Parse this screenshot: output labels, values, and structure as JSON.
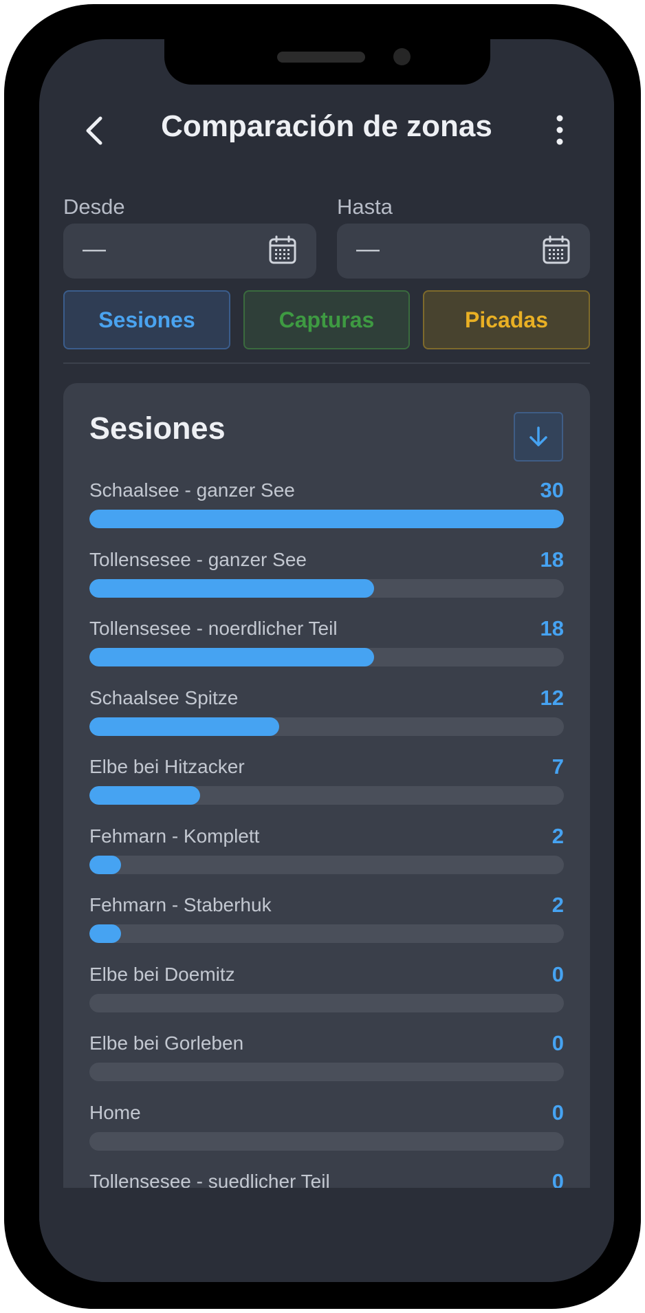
{
  "header": {
    "title": "Comparación de zonas"
  },
  "filters": {
    "from_label": "Desde",
    "from_value": "—",
    "to_label": "Hasta",
    "to_value": "—"
  },
  "metric_buttons": {
    "sesiones": "Sesiones",
    "capturas": "Capturas",
    "picadas": "Picadas"
  },
  "card": {
    "title": "Sesiones",
    "max_value": 30,
    "rows": [
      {
        "label": "Schaalsee - ganzer See",
        "value": 30
      },
      {
        "label": "Tollensesee - ganzer See",
        "value": 18
      },
      {
        "label": "Tollensesee - noerdlicher Teil",
        "value": 18
      },
      {
        "label": "Schaalsee Spitze",
        "value": 12
      },
      {
        "label": "Elbe bei Hitzacker",
        "value": 7
      },
      {
        "label": "Fehmarn - Komplett",
        "value": 2
      },
      {
        "label": "Fehmarn - Staberhuk",
        "value": 2
      },
      {
        "label": "Elbe bei Doemitz",
        "value": 0
      },
      {
        "label": "Elbe bei Gorleben",
        "value": 0
      },
      {
        "label": "Home",
        "value": 0
      },
      {
        "label": "Tollensesee - suedlicher Teil",
        "value": 0
      }
    ]
  },
  "colors": {
    "accent_blue": "#46a3f2",
    "accent_green": "#3e9a42",
    "accent_amber": "#e9b024",
    "background": "#2a2e38",
    "card": "#3a3f4a"
  },
  "icons": {
    "back": "chevron-left-icon",
    "menu": "more-vertical-icon",
    "calendar": "calendar-icon",
    "sort": "arrow-down-icon"
  }
}
